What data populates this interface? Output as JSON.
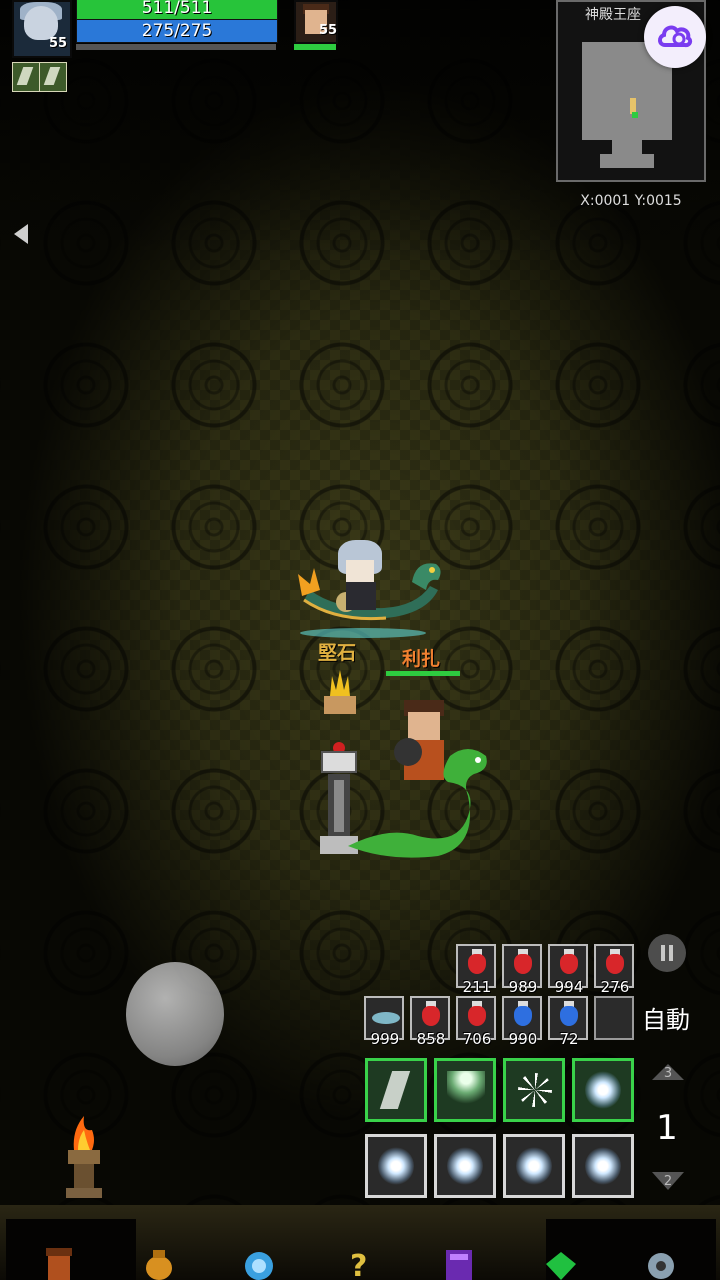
{
  "player": {
    "level": "55",
    "hp_text": "511/511",
    "mp_text": "275/275",
    "hp_fraction": 1.0,
    "mp_fraction": 1.0,
    "xp_fraction": 0.0,
    "name": "堅石"
  },
  "pet": {
    "level": "55",
    "name": "利扎",
    "hp_fraction": 1.0
  },
  "minimap": {
    "title": "神殿王座",
    "coords": "X:0001 Y:0015"
  },
  "items_row1": [
    {
      "icon": "red-potion-icon",
      "color": "#d8262a",
      "qty": "211"
    },
    {
      "icon": "red-potion-icon",
      "color": "#d8262a",
      "qty": "989"
    },
    {
      "icon": "red-potion-icon",
      "color": "#d8262a",
      "qty": "994"
    },
    {
      "icon": "red-potion-icon",
      "color": "#d8262a",
      "qty": "276"
    }
  ],
  "items_row2": [
    {
      "icon": "fish-icon",
      "color": "#7fb7c7",
      "qty": "999"
    },
    {
      "icon": "red-potion-icon",
      "color": "#d8262a",
      "qty": "858"
    },
    {
      "icon": "red-potion-icon",
      "color": "#d8262a",
      "qty": "706"
    },
    {
      "icon": "blue-potion-icon",
      "color": "#2e6fe0",
      "qty": "990"
    },
    {
      "icon": "blue-potion-icon",
      "color": "#2e6fe0",
      "qty": "72"
    }
  ],
  "auto_label": "自動",
  "skill_page": {
    "current": "1",
    "up": "3",
    "down": "2"
  },
  "colors": {
    "accent_green": "#39d24a",
    "hp": "#27c43a",
    "mp": "#2a78d8"
  }
}
